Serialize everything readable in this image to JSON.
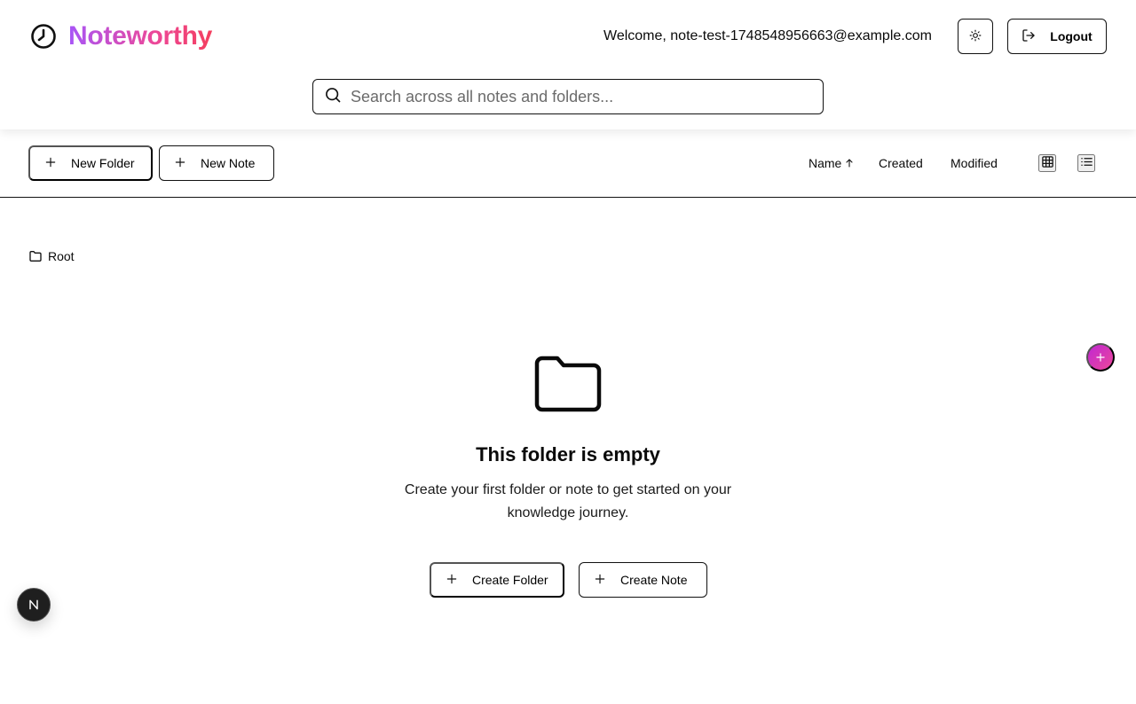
{
  "header": {
    "app_name": "Noteworthy",
    "welcome_text": "Welcome, note-test-1748548956663@example.com",
    "theme_icon": "sun-icon",
    "logout_label": "Logout",
    "search_placeholder": "Search across all notes and folders..."
  },
  "toolbar": {
    "new_folder_label": "New Folder",
    "new_note_label": "New Note",
    "sort_name_label": "Name",
    "sort_created_label": "Created",
    "sort_modified_label": "Modified",
    "sort_direction_icon": "arrow-up-icon",
    "view_icons": [
      "grid-icon",
      "list-icon"
    ]
  },
  "breadcrumb": {
    "root_label": "Root"
  },
  "empty_state": {
    "title": "This folder is empty",
    "description": "Create your first folder or note to get started on your knowledge journey.",
    "create_folder_label": "Create Folder",
    "create_note_label": "Create Note"
  },
  "colors": {
    "brand_gradient_start": "#a855f7",
    "brand_gradient_end": "#f43f5e",
    "fab_gradient_start": "#c026d3",
    "fab_gradient_end": "#ec4899",
    "border": "#111111"
  }
}
